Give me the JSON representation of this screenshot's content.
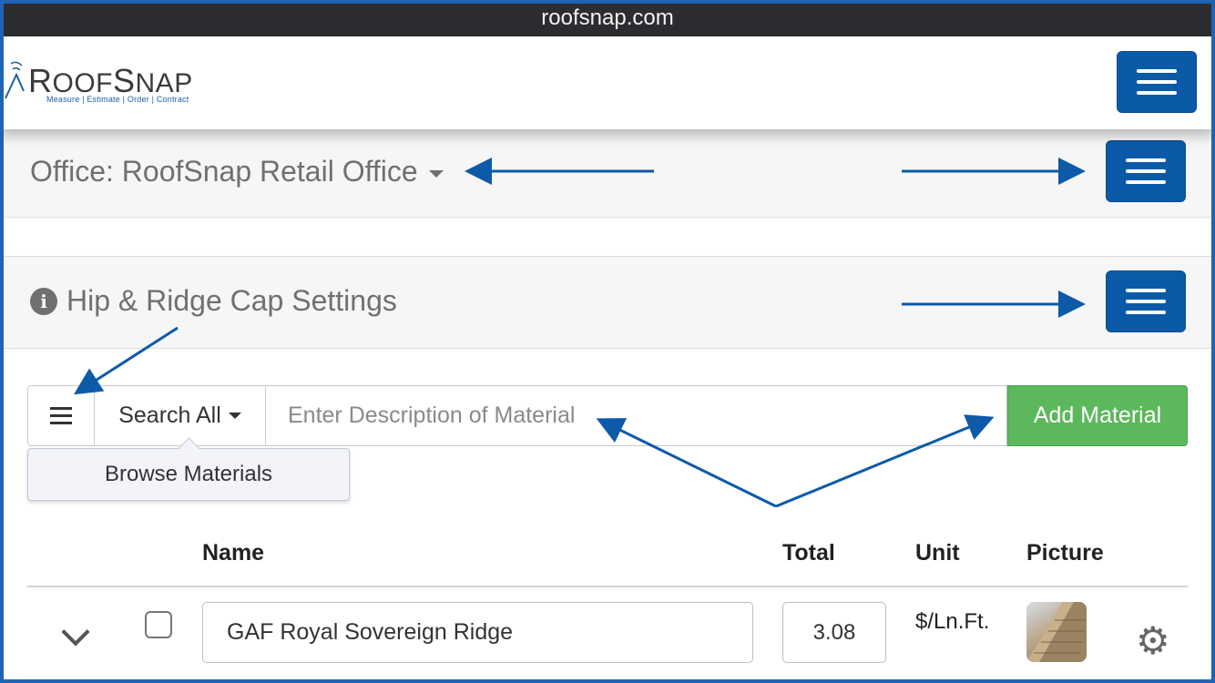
{
  "browser": {
    "url": "roofsnap.com"
  },
  "brand": {
    "name_big1": "R",
    "name_small1": "OOF",
    "name_big2": "S",
    "name_small2": "NAP",
    "tagline": "Measure | Estimate | Order | Contract"
  },
  "office": {
    "title": "Office: RoofSnap Retail Office"
  },
  "section": {
    "title": "Hip & Ridge Cap Settings"
  },
  "search": {
    "filter_label": "Search All",
    "placeholder": "Enter Description of Material",
    "add_label": "Add Material",
    "browse_label": "Browse Materials"
  },
  "table": {
    "headers": {
      "name": "Name",
      "total": "Total",
      "unit": "Unit",
      "picture": "Picture"
    },
    "rows": [
      {
        "name": "GAF Royal Sovereign Ridge",
        "total": "3.08",
        "unit": "$/Ln.Ft."
      }
    ]
  },
  "colors": {
    "primary": "#0b5aa8",
    "success": "#5cb85c",
    "annotation": "#0d5aa8"
  },
  "icons": [
    "hamburger-icon",
    "caret-down-icon",
    "info-icon",
    "menu-icon",
    "chevron-down-icon",
    "checkbox-icon",
    "gear-icon"
  ]
}
